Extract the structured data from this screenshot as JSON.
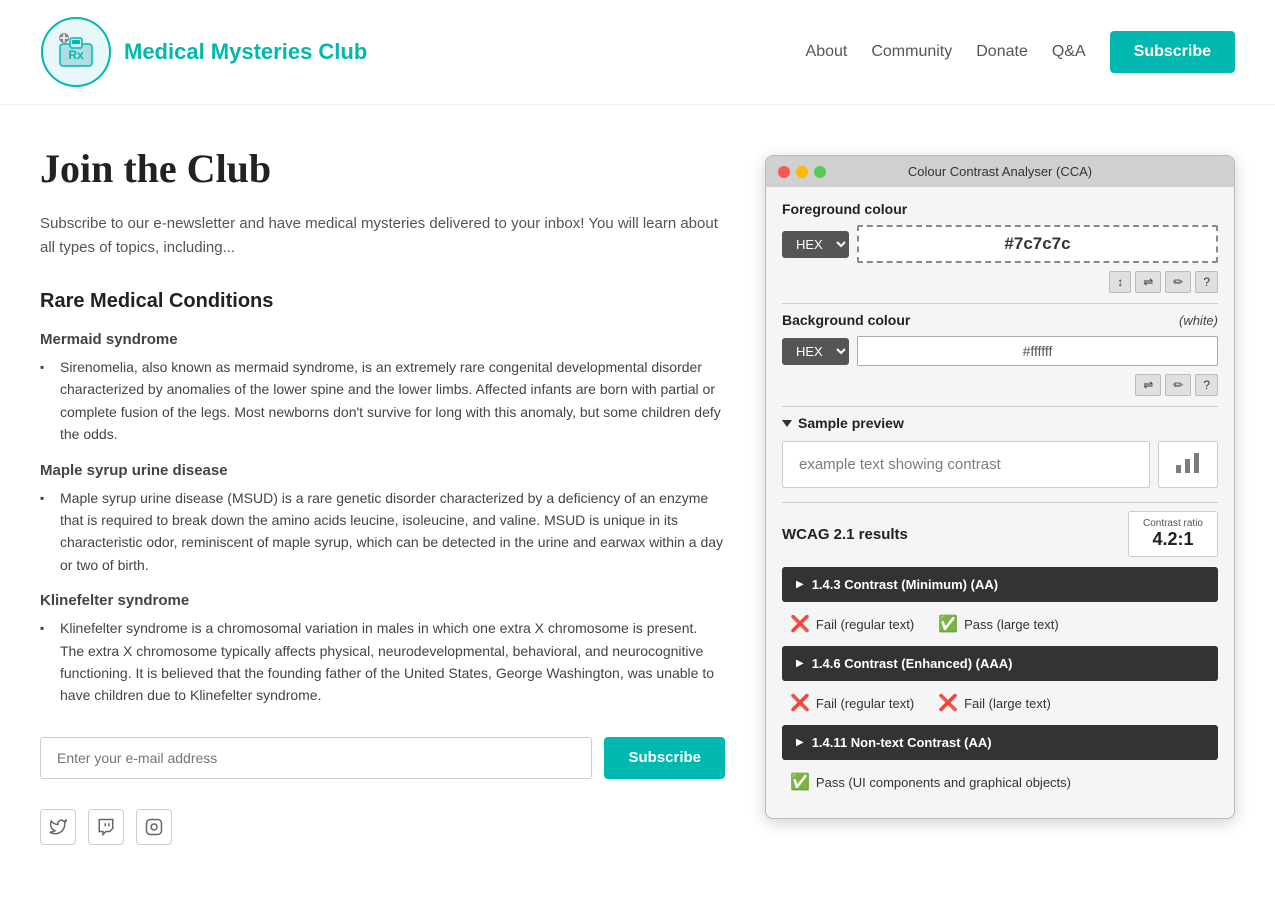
{
  "header": {
    "logo_title": "Medical Mysteries Club",
    "nav": {
      "about": "About",
      "community": "Community",
      "donate": "Donate",
      "qa": "Q&A",
      "subscribe": "Subscribe"
    }
  },
  "main": {
    "page_title": "Join the Club",
    "intro": "Subscribe to our e-newsletter and have medical mysteries delivered to your inbox! You will learn about all types of topics, including...",
    "section_title": "Rare Medical Conditions",
    "conditions": [
      {
        "title": "Mermaid syndrome",
        "description": "Sirenomelia, also known as mermaid syndrome, is an extremely rare congenital developmental disorder characterized by anomalies of the lower spine and the lower limbs. Affected infants are born with partial or complete fusion of the legs. Most newborns don't survive for long with this anomaly, but some children defy the odds."
      },
      {
        "title": "Maple syrup urine disease",
        "description": "Maple syrup urine disease (MSUD) is a rare genetic disorder characterized by a deficiency of an enzyme that is required to break down the amino acids leucine, isoleucine, and valine. MSUD is unique in its characteristic odor, reminiscent of maple syrup, which can be detected in the urine and earwax within a day or two of birth."
      },
      {
        "title": "Klinefelter syndrome",
        "description": "Klinefelter syndrome is a chromosomal variation in males in which one extra X chromosome is present. The extra X chromosome typically affects physical, neurodevelopmental, behavioral, and neurocognitive functioning. It is believed that the founding father of the United States, George Washington, was unable to have children due to Klinefelter syndrome."
      }
    ],
    "email_placeholder": "Enter your e-mail address",
    "subscribe_label": "Subscribe"
  },
  "cca": {
    "title": "Colour Contrast Analyser (CCA)",
    "foreground_label": "Foreground colour",
    "foreground_format": "HEX",
    "foreground_value": "#7c7c7c",
    "background_label": "Background colour",
    "background_white": "(white)",
    "background_format": "HEX",
    "background_value": "#ffffff",
    "sample_preview_label": "Sample preview",
    "sample_text": "example text showing contrast",
    "wcag_label": "WCAG 2.1 results",
    "contrast_ratio_label": "Contrast ratio",
    "contrast_ratio_value": "4.2:1",
    "items": [
      {
        "id": "1.4.3",
        "label": "1.4.3 Contrast (Minimum) (AA)",
        "results": [
          {
            "pass": false,
            "text": "Fail (regular text)"
          },
          {
            "pass": true,
            "text": "Pass (large text)"
          }
        ]
      },
      {
        "id": "1.4.6",
        "label": "1.4.6 Contrast (Enhanced) (AAA)",
        "results": [
          {
            "pass": false,
            "text": "Fail (regular text)"
          },
          {
            "pass": false,
            "text": "Fail (large text)"
          }
        ]
      },
      {
        "id": "1.4.11",
        "label": "1.4.11 Non-text Contrast (AA)",
        "results": [
          {
            "pass": true,
            "text": "Pass (UI components and graphical objects)"
          }
        ]
      }
    ]
  }
}
